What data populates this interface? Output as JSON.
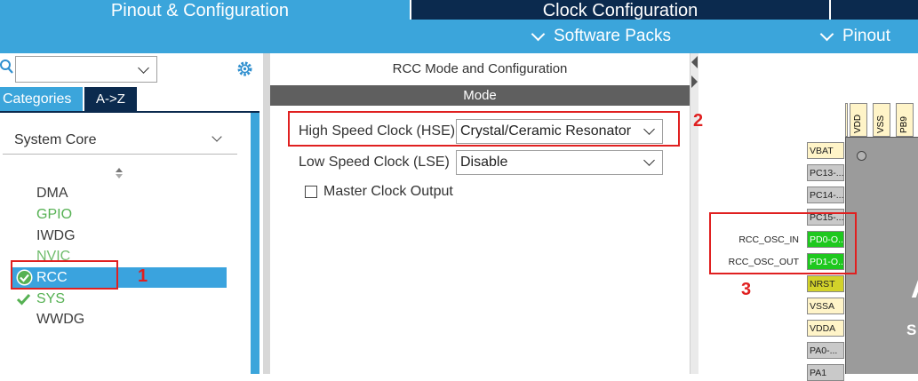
{
  "tabs": [
    {
      "label": "Pinout & Configuration"
    },
    {
      "label": "Clock Configuration"
    }
  ],
  "menu": {
    "software_packs": "Software Packs",
    "pinout": "Pinout"
  },
  "left": {
    "search_value": "",
    "tab_categories": "Categories",
    "tab_az": "A->Z",
    "category": "System Core",
    "items": [
      "DMA",
      "GPIO",
      "IWDG",
      "NVIC",
      "RCC",
      "SYS",
      "WWDG"
    ]
  },
  "center": {
    "title": "RCC Mode and Configuration",
    "mode_header": "Mode",
    "hse_label": "High Speed Clock (HSE)",
    "hse_value": "Crystal/Ceramic Resonator",
    "lse_label": "Low Speed Clock (LSE)",
    "lse_value": "Disable",
    "mco_label": "Master Clock Output"
  },
  "chip": {
    "top_pins": [
      "VDD",
      "VSS",
      "PB9"
    ],
    "left_pins": [
      "VBAT",
      "PC13-...",
      "PC14-...",
      "PC15-...",
      "PD0-O...",
      "PD1-O...",
      "NRST",
      "VSSA",
      "VDDA",
      "PA0-...",
      "PA1"
    ],
    "signal_in": "RCC_OSC_IN",
    "signal_out": "RCC_OSC_OUT",
    "chip_letters": [
      "A",
      "S"
    ]
  },
  "annotations": [
    "1",
    "2",
    "3"
  ],
  "colors": {
    "navy": "#0b2a4e",
    "blue": "#3ba5db",
    "selected": "#3aa3de",
    "mode_bar": "#5f5f5f",
    "red": "#e02020",
    "pin_green": "#1ec81e"
  }
}
